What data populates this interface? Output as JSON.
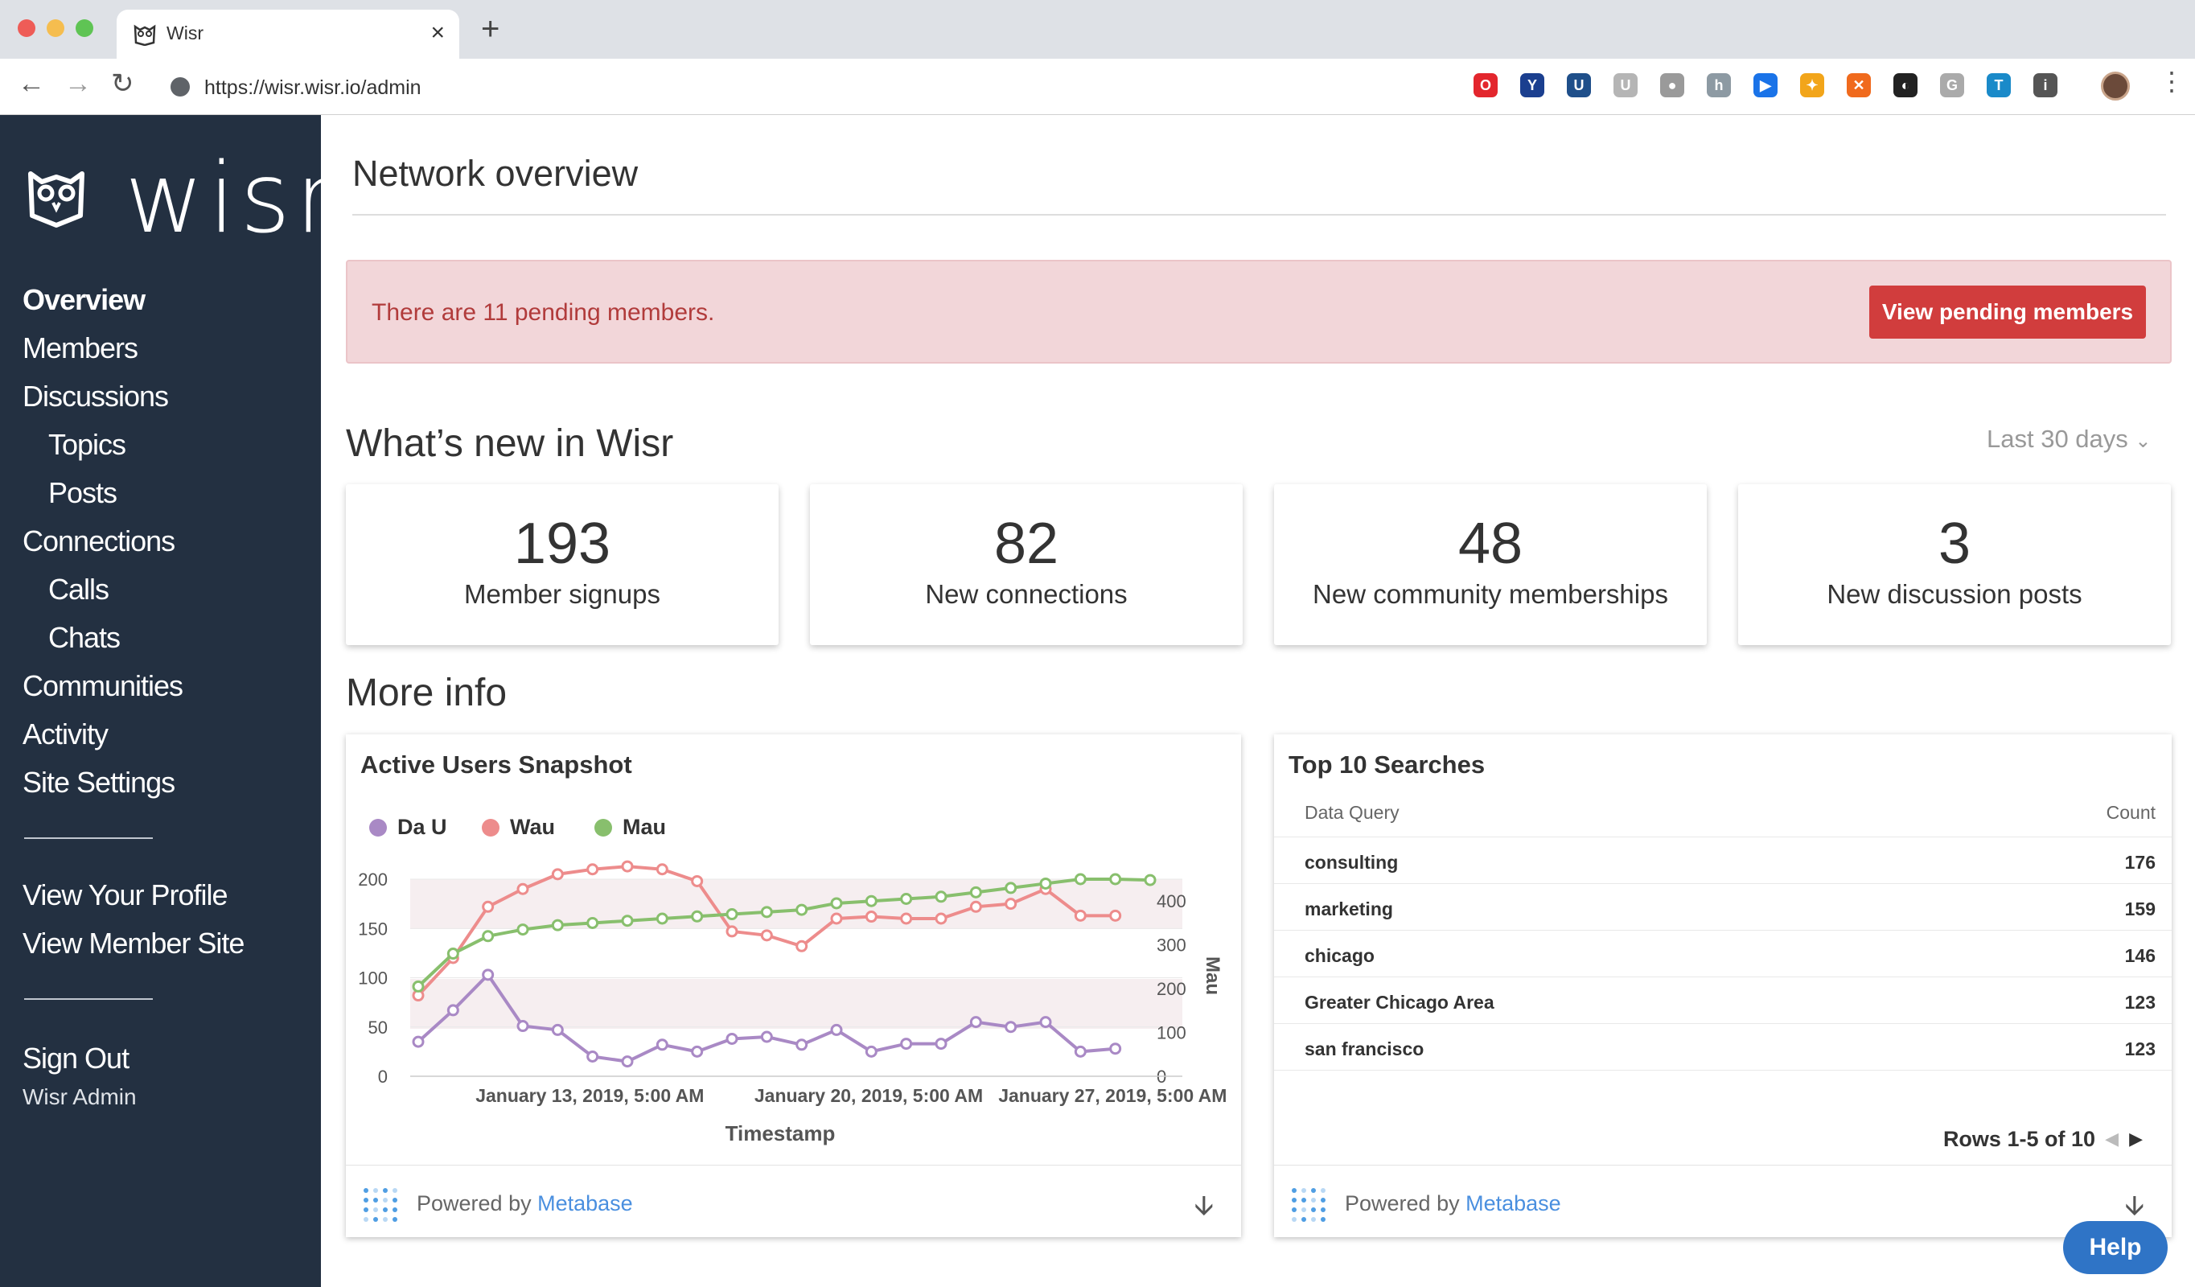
{
  "browser": {
    "tab_title": "Wisr",
    "url": "https://wisr.wisr.io/admin",
    "extensions": [
      {
        "icon": "opera-icon",
        "color": "#e3262d",
        "glyph": "O"
      },
      {
        "icon": "vimeo-icon",
        "color": "#1b3f8f",
        "glyph": "Y"
      },
      {
        "icon": "ublock-icon",
        "color": "#1f4f8a",
        "glyph": "U"
      },
      {
        "icon": "extension-icon",
        "color": "#b5b5b5",
        "glyph": "U"
      },
      {
        "icon": "extension-icon",
        "color": "#9a9a9a",
        "glyph": "●"
      },
      {
        "icon": "extension-icon",
        "color": "#8d9aa3",
        "glyph": "h"
      },
      {
        "icon": "screen-icon",
        "color": "#1a73e8",
        "glyph": "▶"
      },
      {
        "icon": "pinwheel-icon",
        "color": "#f2a51a",
        "glyph": "✦"
      },
      {
        "icon": "orange-extension-icon",
        "color": "#f06a1d",
        "glyph": "✕"
      },
      {
        "icon": "dark-circle-icon",
        "color": "#222222",
        "glyph": "◐"
      },
      {
        "icon": "grammarly-icon",
        "color": "#aaaaaa",
        "glyph": "G"
      },
      {
        "icon": "trello-icon",
        "color": "#1a8ac9",
        "glyph": "T"
      },
      {
        "icon": "info-icon",
        "color": "#555555",
        "glyph": "i"
      }
    ]
  },
  "brand": {
    "name": "wisr"
  },
  "sidebar": {
    "items": [
      {
        "label": "Overview"
      },
      {
        "label": "Members"
      },
      {
        "label": "Discussions"
      },
      {
        "label": "Topics"
      },
      {
        "label": "Posts"
      },
      {
        "label": "Connections"
      },
      {
        "label": "Calls"
      },
      {
        "label": "Chats"
      },
      {
        "label": "Communities"
      },
      {
        "label": "Activity"
      },
      {
        "label": "Site Settings"
      }
    ],
    "profile_link": "View Your Profile",
    "member_site_link": "View Member Site",
    "sign_out": "Sign Out",
    "user_name": "Wisr Admin"
  },
  "page": {
    "title": "Network overview",
    "alert_text": "There are 11 pending members.",
    "alert_button": "View pending members",
    "whats_new_title": "What’s new in Wisr",
    "range_label": "Last 30 days",
    "more_info_title": "More info"
  },
  "stats": [
    {
      "value": "193",
      "label": "Member signups"
    },
    {
      "value": "82",
      "label": "New connections"
    },
    {
      "value": "48",
      "label": "New community memberships"
    },
    {
      "value": "3",
      "label": "New discussion posts"
    }
  ],
  "active_users": {
    "title": "Active Users Snapshot",
    "legend": [
      "Da U",
      "Wau",
      "Mau"
    ]
  },
  "chart_data": {
    "type": "line",
    "title": "Active Users Snapshot",
    "xlabel": "Timestamp",
    "ylabel_left": "",
    "ylabel_right": "Mau",
    "x_tick_labels": [
      "January 13, 2019, 5:00 AM",
      "January 20, 2019, 5:00 AM",
      "January 27, 2019, 5:00 AM"
    ],
    "y_left_ticks": [
      "0",
      "50",
      "100",
      "150",
      "200"
    ],
    "y_right_ticks": [
      "0",
      "100",
      "200",
      "300",
      "400"
    ],
    "ylim_left": [
      0,
      200
    ],
    "ylim_right": [
      0,
      450
    ],
    "x": [
      "2019-01-06",
      "2019-01-07",
      "2019-01-08",
      "2019-01-09",
      "2019-01-10",
      "2019-01-11",
      "2019-01-12",
      "2019-01-13",
      "2019-01-14",
      "2019-01-15",
      "2019-01-16",
      "2019-01-17",
      "2019-01-18",
      "2019-01-19",
      "2019-01-20",
      "2019-01-21",
      "2019-01-22",
      "2019-01-23",
      "2019-01-24",
      "2019-01-25",
      "2019-01-26",
      "2019-01-27",
      "2019-01-28",
      "2019-01-29"
    ],
    "series": [
      {
        "name": "Da U",
        "axis": "left",
        "color": "#a989c5",
        "values": [
          35,
          67,
          103,
          51,
          47,
          20,
          15,
          32,
          25,
          38,
          40,
          32,
          47,
          25,
          33,
          33,
          55,
          50,
          55,
          25,
          28
        ]
      },
      {
        "name": "Wau",
        "axis": "left",
        "color": "#ed8c8c",
        "values": [
          82,
          120,
          172,
          190,
          205,
          210,
          213,
          210,
          198,
          147,
          143,
          132,
          160,
          162,
          160,
          160,
          172,
          175,
          190,
          163,
          163
        ]
      },
      {
        "name": "Mau",
        "axis": "right",
        "color": "#88bf6d",
        "values": [
          205,
          280,
          320,
          335,
          345,
          350,
          355,
          360,
          365,
          370,
          375,
          380,
          395,
          400,
          405,
          410,
          420,
          430,
          440,
          450,
          450,
          448
        ]
      }
    ],
    "legend": "top-left",
    "grid": true
  },
  "searches": {
    "title": "Top 10 Searches",
    "columns": [
      "Data Query",
      "Count"
    ],
    "rows": [
      {
        "query": "consulting",
        "count": "176"
      },
      {
        "query": "marketing",
        "count": "159"
      },
      {
        "query": "chicago",
        "count": "146"
      },
      {
        "query": "Greater Chicago Area",
        "count": "123"
      },
      {
        "query": "san francisco",
        "count": "123"
      }
    ],
    "pagination": "Rows 1-5 of 10"
  },
  "footer": {
    "powered_by": "Powered by",
    "metabase": "Metabase"
  },
  "help": {
    "label": "Help"
  }
}
